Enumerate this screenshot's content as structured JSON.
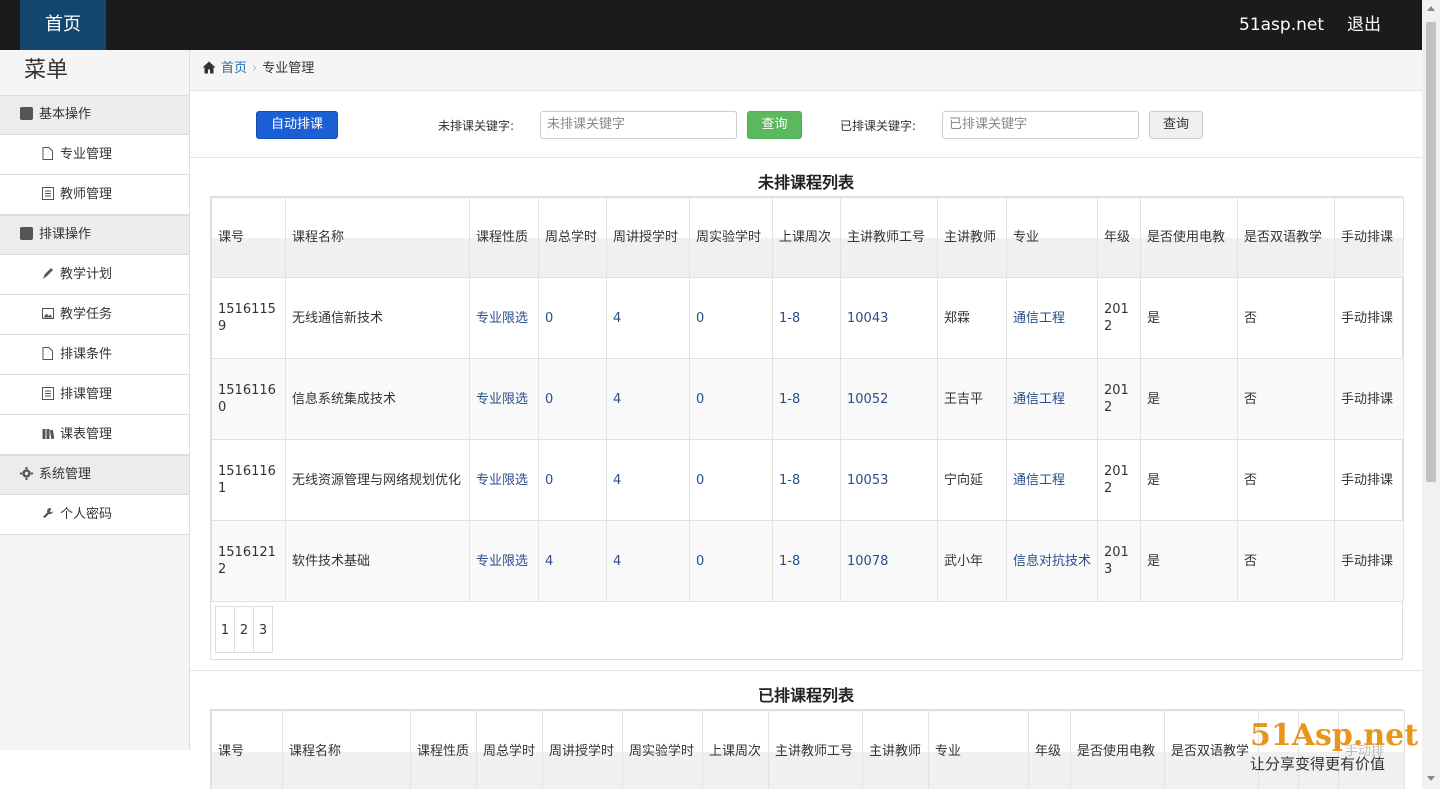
{
  "header": {
    "brand": "首页",
    "site": "51asp.net",
    "logout": "退出"
  },
  "sidebar": {
    "title": "菜单",
    "groups": [
      {
        "label": "基本操作",
        "items": [
          {
            "label": "专业管理"
          },
          {
            "label": "教师管理"
          }
        ]
      },
      {
        "label": "排课操作",
        "items": [
          {
            "label": "教学计划"
          },
          {
            "label": "教学任务"
          },
          {
            "label": "排课条件"
          },
          {
            "label": "排课管理"
          },
          {
            "label": "课表管理"
          }
        ]
      },
      {
        "label": "系统管理",
        "items": [
          {
            "label": "个人密码"
          }
        ]
      }
    ]
  },
  "breadcrumb": {
    "home": "首页",
    "current": "专业管理"
  },
  "toolbar": {
    "auto_label": "自动排课",
    "unscheduled_label": "未排课关键字:",
    "unscheduled_placeholder": "未排课关键字",
    "query1": "查询",
    "scheduled_label": "已排课关键字:",
    "scheduled_placeholder": "已排课关键字",
    "query2": "查询"
  },
  "unscheduled": {
    "title": "未排课程列表",
    "columns": [
      "课号",
      "课程名称",
      "课程性质",
      "周总学时",
      "周讲授学时",
      "周实验学时",
      "上课周次",
      "主讲教师工号",
      "主讲教师",
      "专业",
      "年级",
      "是否使用电教",
      "是否双语教学",
      "手动排课"
    ],
    "rows": [
      [
        "15161159",
        "无线通信新技术",
        "专业限选",
        "0",
        "4",
        "0",
        "1-8",
        "10043",
        "郑霖",
        "通信工程",
        "2012",
        "是",
        "否",
        "手动排课"
      ],
      [
        "15161160",
        "信息系统集成技术",
        "专业限选",
        "0",
        "4",
        "0",
        "1-8",
        "10052",
        "王吉平",
        "通信工程",
        "2012",
        "是",
        "否",
        "手动排课"
      ],
      [
        "15161161",
        "无线资源管理与网络规划优化",
        "专业限选",
        "0",
        "4",
        "0",
        "1-8",
        "10053",
        "宁向延",
        "通信工程",
        "2012",
        "是",
        "否",
        "手动排课"
      ],
      [
        "15161212",
        "软件技术基础",
        "专业限选",
        "4",
        "4",
        "0",
        "1-8",
        "10078",
        "武小年",
        "信息对抗技术",
        "2013",
        "是",
        "否",
        "手动排课"
      ]
    ],
    "pages": [
      "1",
      "2",
      "3"
    ]
  },
  "scheduled": {
    "title": "已排课程列表",
    "columns": [
      "课号",
      "课程名称",
      "课程性质",
      "周总学时",
      "周讲授学时",
      "周实验学时",
      "上课周次",
      "主讲教师工号",
      "主讲教师",
      "专业",
      "年级",
      "是否使用电教",
      "是否双语教学",
      "",
      "",
      "手动排"
    ]
  },
  "watermark": {
    "logo": "51Asp.net",
    "slogan": "让分享变得更有价值"
  }
}
